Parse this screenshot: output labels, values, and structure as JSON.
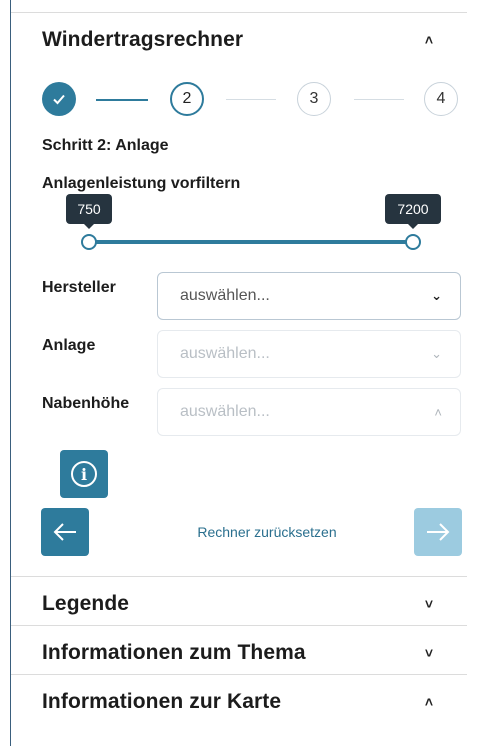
{
  "calculator": {
    "title": "Windertragsrechner",
    "collapse_icon": "chevron-up-icon",
    "steps": [
      {
        "label": "✓",
        "state": "done",
        "icon": "checkmark-icon"
      },
      {
        "label": "2",
        "state": "current"
      },
      {
        "label": "3",
        "state": "todo"
      },
      {
        "label": "4",
        "state": "todo"
      }
    ],
    "step_title": "Schritt 2: Anlage",
    "filter_title": "Anlagenleistung vorfiltern",
    "slider": {
      "min_value": "750",
      "max_value": "7200"
    },
    "fields": [
      {
        "label": "Hersteller",
        "placeholder": "auswählen...",
        "enabled": true,
        "caret": "chevron-down-icon"
      },
      {
        "label": "Anlage",
        "placeholder": "auswählen...",
        "enabled": false,
        "caret": "chevron-down-icon"
      },
      {
        "label": "Nabenhöhe",
        "placeholder": "auswählen...",
        "enabled": false,
        "caret": "chevron-up-icon"
      }
    ],
    "info_icon": "info-icon",
    "back_icon": "arrow-left-icon",
    "next_icon": "arrow-right-icon",
    "reset_label": "Rechner zurücksetzen"
  },
  "sections": [
    {
      "title": "Legende",
      "chevron": "˅"
    },
    {
      "title": "Informationen zum Thema",
      "chevron": "˅"
    },
    {
      "title": "Informationen zur Karte",
      "chevron": "˄"
    }
  ],
  "colors": {
    "accent": "#2e7b9c",
    "accent_disabled": "#9ccbe0",
    "tooltip_bg": "#26343f",
    "link": "#2a6f8e"
  }
}
